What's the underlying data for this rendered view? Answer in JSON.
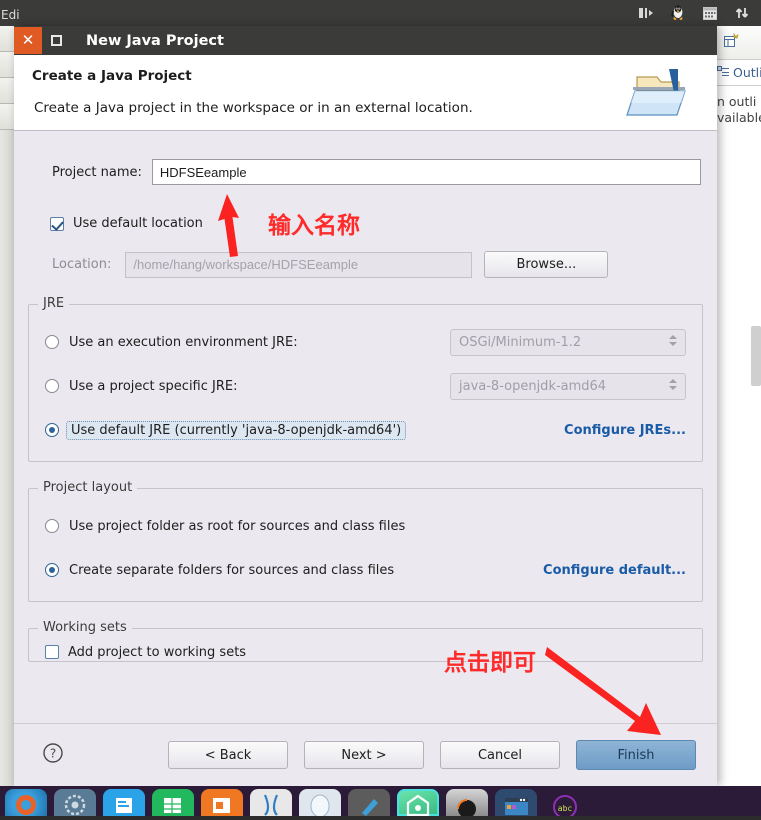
{
  "window": {
    "title": "New Java Project",
    "close_glyph": "✕",
    "background_menu_text": "Edi"
  },
  "systray": [
    {
      "name": "panel-layout-icon"
    },
    {
      "name": "linux-penguin-icon"
    },
    {
      "name": "calendar-icon"
    },
    {
      "name": "network-updown-icon"
    }
  ],
  "dialog": {
    "header_title": "Create a Java Project",
    "header_subtitle": "Create a Java project in the workspace or in an external location.",
    "header_icon": "java-project-folder-icon",
    "project_name_label": "Project name:",
    "project_name_value": "HDFSEeample",
    "use_default_location_label": "Use default location",
    "use_default_location_checked": true,
    "location_label": "Location:",
    "location_value": "/home/hang/workspace/HDFSEeample",
    "browse_label": "Browse...",
    "jre": {
      "group_title": "JRE",
      "options": [
        {
          "label": "Use an execution environment JRE:",
          "selected": false,
          "combo": "OSGi/Minimum-1.2"
        },
        {
          "label": "Use a project specific JRE:",
          "selected": false,
          "combo": "java-8-openjdk-amd64"
        },
        {
          "label": "Use default JRE (currently 'java-8-openjdk-amd64')",
          "selected": true,
          "combo": null
        }
      ],
      "configure_link": "Configure JREs..."
    },
    "layout": {
      "group_title": "Project layout",
      "options": [
        {
          "label": "Use project folder as root for sources and class files",
          "selected": false
        },
        {
          "label": "Create separate folders for sources and class files",
          "selected": true
        }
      ],
      "configure_link": "Configure default..."
    },
    "working_sets": {
      "group_title": "Working sets",
      "checkbox_label": "Add project to working sets",
      "checked": false
    },
    "buttons": {
      "help": "?",
      "back": "< Back",
      "next": "Next >",
      "cancel": "Cancel",
      "finish": "Finish"
    }
  },
  "annotations": [
    {
      "text": "输入名称",
      "color": "#ff2b2b",
      "points_to": "project-name-input"
    },
    {
      "text": "点击即可",
      "color": "#ff2b2b",
      "points_to": "finish-button"
    }
  ],
  "outline_view": {
    "tab_label": "Outli",
    "message_line1": "n outli",
    "message_line2": "vailable"
  },
  "taskbar": {
    "icons": [
      {
        "name": "firefox-icon",
        "color": "#3aa0dd",
        "accent": "#e8622a"
      },
      {
        "name": "settings-icon",
        "color": "#5a7b96",
        "accent": "#cfd9e0"
      },
      {
        "name": "files-icon",
        "color": "#2aa3e8",
        "accent": "#ffffff"
      },
      {
        "name": "calc-icon",
        "color": "#22b85e",
        "accent": "#ffffff"
      },
      {
        "name": "presentation-icon",
        "color": "#f07822",
        "accent": "#ffffff"
      },
      {
        "name": "amazon-icon",
        "color": "#e8e8e8",
        "accent": "#2f7fc4"
      },
      {
        "name": "ubuntu-software-icon",
        "color": "#dfe6ee",
        "accent": "#9fb8cc"
      },
      {
        "name": "help-icon",
        "color": "#5c5c5c",
        "accent": "#3c9fd8"
      },
      {
        "name": "eclipse-home-icon",
        "color": "#58d69a",
        "accent": "#ffffff"
      },
      {
        "name": "terminal-dark-icon",
        "color": "#8c8c8c",
        "accent": "#1a1a1a"
      },
      {
        "name": "window-app-icon",
        "color": "#3d86c6",
        "accent": "#e8a33d"
      },
      {
        "name": "text-editor-icon",
        "color": "#8f2fb5",
        "accent": "#cde053"
      }
    ]
  }
}
